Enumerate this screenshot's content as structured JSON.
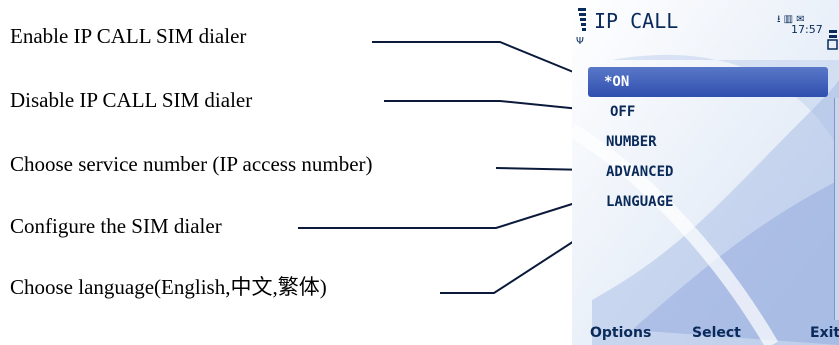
{
  "annotations": [
    "Enable IP CALL SIM dialer",
    "Disable IP CALL SIM dialer",
    "Choose service number (IP access number)",
    "Configure the SIM dialer",
    "Choose language(English,中文,繁体)"
  ],
  "phone": {
    "title": "IP CALL",
    "time": "17:57",
    "status_icons": "⭳ ▥ ✉",
    "menu": [
      "*ON",
      "OFF",
      "NUMBER",
      "ADVANCED",
      "LANGUAGE"
    ],
    "softkeys": {
      "left": "Options",
      "middle": "Select",
      "right": "Exit"
    }
  },
  "colors": {
    "accent": "#3a58b8",
    "text": "#0a2a5a",
    "line": "#0b1a3a"
  }
}
